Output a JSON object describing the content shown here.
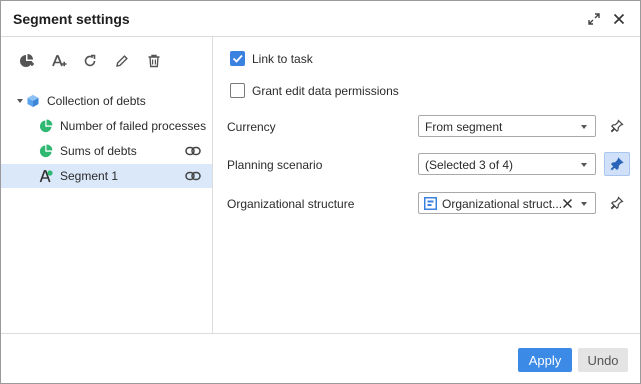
{
  "dialog": {
    "title": "Segment settings"
  },
  "left_panel": {
    "toolbar": [
      {
        "name": "add-pie-segment-icon"
      },
      {
        "name": "add-text-segment-icon"
      },
      {
        "name": "refresh-icon"
      },
      {
        "name": "edit-icon"
      },
      {
        "name": "delete-icon"
      }
    ],
    "tree": {
      "root": {
        "label": "Collection of debts",
        "icon": "cube-icon",
        "expanded": true
      },
      "children": [
        {
          "label": "Number of failed processes",
          "icon": "pie-segment-icon",
          "linked": false,
          "selected": false
        },
        {
          "label": "Sums of debts",
          "icon": "pie-segment-icon",
          "linked": true,
          "selected": false
        },
        {
          "label": "Segment 1",
          "icon": "text-segment-icon",
          "linked": true,
          "selected": true
        }
      ]
    }
  },
  "right_panel": {
    "link_to_task": {
      "label": "Link to task",
      "checked": true
    },
    "grant_edit": {
      "label": "Grant edit data permissions",
      "checked": false
    },
    "currency": {
      "label": "Currency",
      "value": "From segment",
      "pinned": false
    },
    "planning_scenario": {
      "label": "Planning scenario",
      "value": "(Selected 3 of 4)",
      "pinned": true
    },
    "org_structure": {
      "label": "Organizational structure",
      "value": "Organizational struct...",
      "pinned": false
    }
  },
  "footer": {
    "apply_label": "Apply",
    "undo_label": "Undo"
  },
  "colors": {
    "accent": "#3b8ae6",
    "selected_row": "#dbe8fa",
    "pie_green": "#2eb872"
  }
}
